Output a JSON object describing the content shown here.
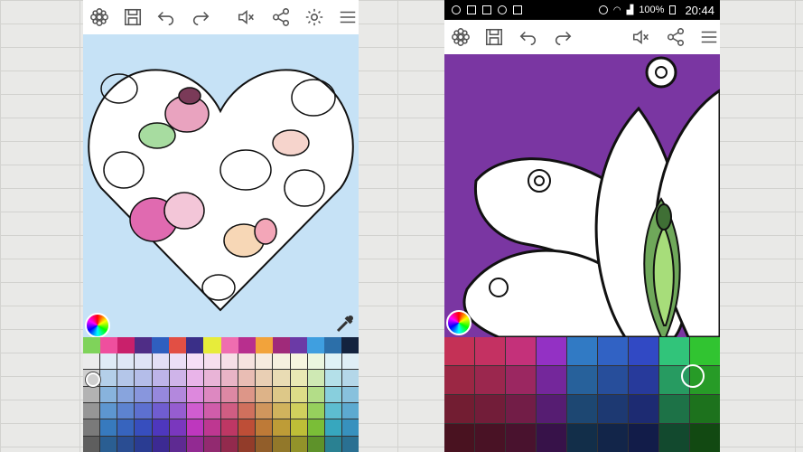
{
  "status_bar": {
    "battery_pct": "100%",
    "time": "20:44"
  },
  "toolbar_icons": [
    "palette-icon",
    "save-icon",
    "undo-icon",
    "redo-icon",
    "mute-icon",
    "share-icon",
    "settings-icon",
    "menu-icon"
  ],
  "colors": {
    "canvas_left": "#c6e2f6",
    "canvas_right": "#7a36a2"
  }
}
